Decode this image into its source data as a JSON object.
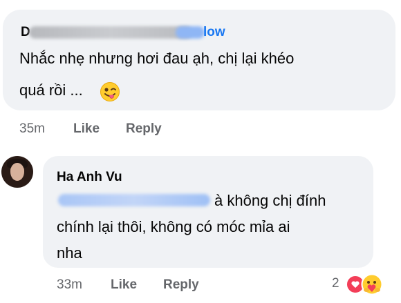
{
  "comment1": {
    "author_initial": "D",
    "author_suffix": "low",
    "text_line1": "Nhắc nhẹ nhưng hơi đau ạh, chị lại khéo",
    "text_line2": "quá rồi ...",
    "emoji": "winking-face-tongue-icon",
    "time": "35m",
    "like_label": "Like",
    "reply_label": "Reply"
  },
  "comment2": {
    "author": "Ha Anh Vu",
    "text_line1": "à không chị đính",
    "text_line2": "chính lại thôi, không có móc mỉa ai",
    "text_line3": "nha",
    "time": "33m",
    "like_label": "Like",
    "reply_label": "Reply",
    "reaction_count": "2",
    "reactions": [
      "heart-icon",
      "care-icon"
    ]
  },
  "colors": {
    "bubble": "#f0f2f5",
    "text": "#050505",
    "meta": "#65676b",
    "link": "#1877f2",
    "heart": "#f33e58"
  }
}
